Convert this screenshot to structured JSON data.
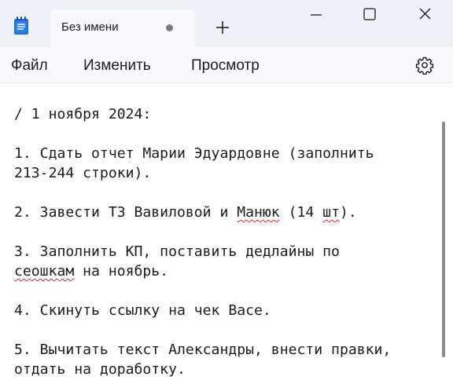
{
  "window": {
    "tab_title": "Без имени",
    "tab_unsaved_indicator": "dot",
    "new_tab_icon": "plus-icon",
    "app_icon": "notepad-icon",
    "controls": [
      "minimize-icon",
      "maximize-icon",
      "close-icon"
    ]
  },
  "menu": {
    "file": "Файл",
    "edit": "Изменить",
    "view": "Просмотр",
    "settings_icon": "gear-icon"
  },
  "document": {
    "line1": "/ 1 ноября 2024:",
    "line2": "1. Сдать отчет Марии Эдуардовне (заполнить",
    "line3": "213-244 строки).",
    "line4_a": "2. Завести ТЗ Вавиловой и ",
    "line4_b": "Манюк",
    "line4_c": " (14 ",
    "line4_d": "шт",
    "line4_e": ").",
    "line5": "3. Заполнить КП, поставить дедлайны по",
    "line6_a": "сеошкам",
    "line6_b": " на ноябрь.",
    "line7": "4. Скинуть ссылку на чек Васе.",
    "line8": "5. Вычитать текст Александры, внести правки,",
    "line9": "отдать на доработку."
  },
  "colors": {
    "titlebar_bg": "#eef2f8",
    "tab_bg": "#f9fafd",
    "text": "#1b1b1b",
    "spellcheck": "#d0262c",
    "app_icon_blue": "#1e6fd9"
  }
}
